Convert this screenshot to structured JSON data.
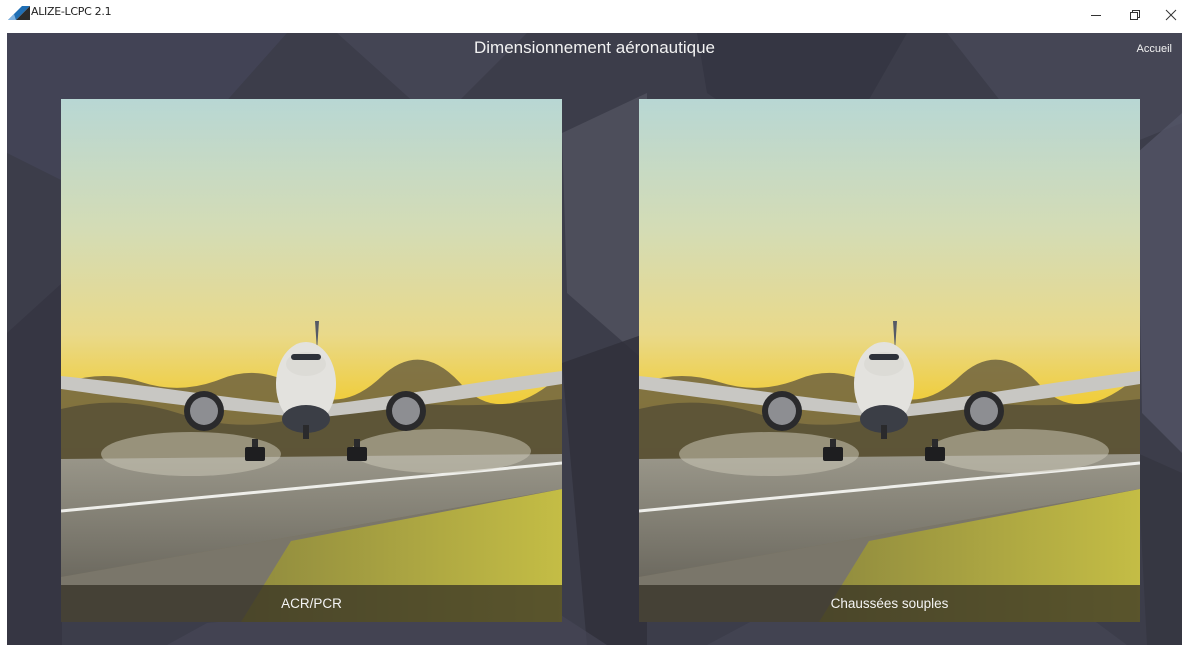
{
  "window": {
    "app_title": "ALIZE-LCPC 2.1",
    "controls": {
      "minimize_icon": "minimize-icon",
      "maximize_icon": "restore-icon",
      "close_icon": "close-icon"
    }
  },
  "header": {
    "title": "Dimensionnement aéronautique",
    "home_link": "Accueil"
  },
  "cards": [
    {
      "label": "ACR/PCR",
      "image": "airplane-landing-photo"
    },
    {
      "label": "Chaussées souples",
      "image": "airplane-landing-photo"
    }
  ],
  "colors": {
    "background": "#3c3d4a",
    "label_bar": "#302c22",
    "text": "#f2f2f2"
  }
}
